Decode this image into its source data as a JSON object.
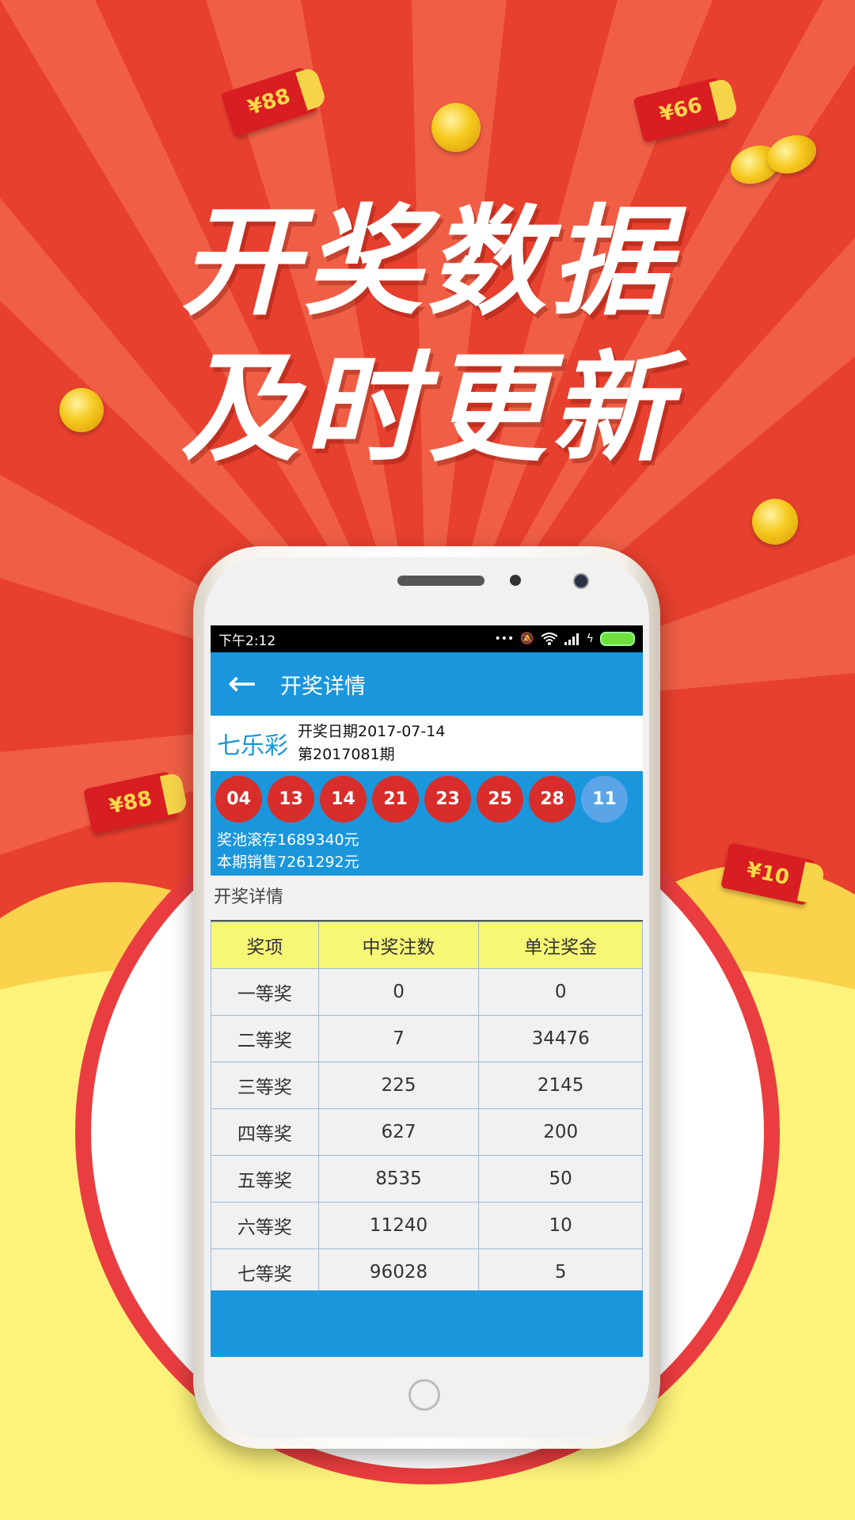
{
  "headline": {
    "line1": "开奖数据",
    "line2": "及时更新"
  },
  "colors": {
    "accent": "#1a96dc",
    "ball_red": "#d82d2a",
    "ball_blue": "#5aa5e8",
    "header_yellow": "#f7f776",
    "bg_red": "#e8402e"
  },
  "decor": {
    "packets": [
      "¥88",
      "¥66",
      "¥88",
      "¥10"
    ]
  },
  "status_bar": {
    "time": "下午2:12",
    "icons": [
      "more-icon",
      "mute-bell-icon",
      "wifi-icon",
      "signal-icon",
      "charging-icon",
      "battery-icon"
    ]
  },
  "app_bar": {
    "back_icon": "back-arrow-icon",
    "title": "开奖详情"
  },
  "lottery": {
    "name": "七乐彩",
    "date_line": "开奖日期2017-07-14",
    "issue_line": "第2017081期",
    "balls": [
      "04",
      "13",
      "14",
      "21",
      "23",
      "25",
      "28"
    ],
    "special_ball": "11",
    "pool_line": "奖池滚存1689340元",
    "sales_line": "本期销售7261292元"
  },
  "details": {
    "section_title": "开奖详情",
    "headers": [
      "奖项",
      "中奖注数",
      "单注奖金"
    ],
    "rows": [
      [
        "一等奖",
        "0",
        "0"
      ],
      [
        "二等奖",
        "7",
        "34476"
      ],
      [
        "三等奖",
        "225",
        "2145"
      ],
      [
        "四等奖",
        "627",
        "200"
      ],
      [
        "五等奖",
        "8535",
        "50"
      ],
      [
        "六等奖",
        "11240",
        "10"
      ],
      [
        "七等奖",
        "96028",
        "5"
      ]
    ]
  }
}
